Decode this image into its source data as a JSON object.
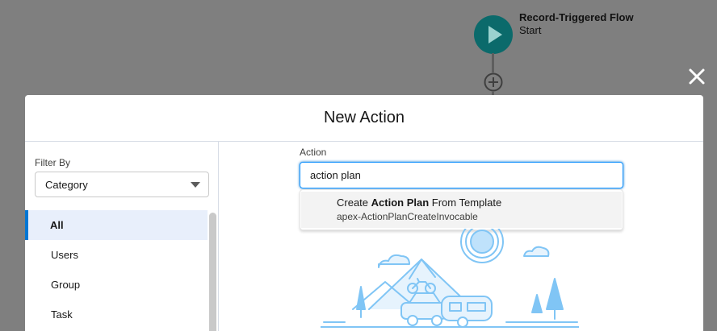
{
  "canvas": {
    "flow_title": "Record-Triggered Flow",
    "flow_subtitle": "Start",
    "start_icon": "play-icon",
    "add_icon": "plus-circle-icon",
    "close_icon": "close-icon"
  },
  "modal": {
    "title": "New Action",
    "filter": {
      "label": "Filter By",
      "selected": "Category"
    },
    "categories": [
      {
        "label": "All",
        "active": true
      },
      {
        "label": "Users",
        "active": false
      },
      {
        "label": "Group",
        "active": false
      },
      {
        "label": "Task",
        "active": false
      }
    ],
    "action": {
      "label": "Action",
      "value": "action plan",
      "suggestion": {
        "prefix": "Create ",
        "match": "Action Plan",
        "suffix": " From Template",
        "api_name": "apex-ActionPlanCreateInvocable"
      }
    }
  },
  "colors": {
    "overlay": "#7f7f7f",
    "start_node": "#0b6a6b",
    "brand": "#0176d3",
    "active_row": "#e8effb",
    "illustration": "#80c5f5"
  }
}
